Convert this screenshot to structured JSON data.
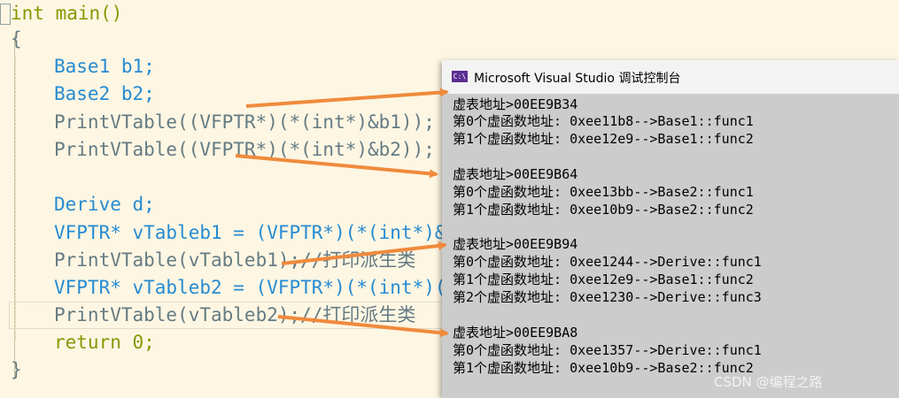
{
  "code": {
    "lines": [
      "int main()",
      "{",
      "Base1 b1;",
      "Base2 b2;",
      "PrintVTable((VFPTR*)(*(int*)&b1));",
      "PrintVTable((VFPTR*)(*(int*)&b2));",
      "Derive d;",
      "VFPTR* vTableb1 = (VFPTR*)(*(int*)&",
      "PrintVTable(vTableb1);//打印派生类",
      "VFPTR* vTableb2 = (VFPTR*)(*(int*)(",
      "PrintVTable(vTableb2);//打印派生类",
      "return 0;",
      "}"
    ]
  },
  "console": {
    "title": "Microsoft Visual Studio 调试控制台",
    "icon_label": "C:\\",
    "lines": [
      "虚表地址>00EE9B34",
      "第0个虚函数地址: 0xee11b8-->Base1::func1",
      "第1个虚函数地址: 0xee12e9-->Base1::func2",
      "虚表地址>00EE9B64",
      "第0个虚函数地址: 0xee13bb-->Base2::func1",
      "第1个虚函数地址: 0xee10b9-->Base2::func2",
      "虚表地址>00EE9B94",
      "第0个虚函数地址: 0xee1244-->Derive::func1",
      "第1个虚函数地址: 0xee12e9-->Base1::func2",
      "第2个虚函数地址: 0xee1230-->Derive::func3",
      "虚表地址>00EE9BA8",
      "第0个虚函数地址: 0xee1357-->Derive::func1",
      "第1个虚函数地址: 0xee10b9-->Base2::func2"
    ]
  },
  "watermark": "CSDN @编程之路",
  "colors": {
    "editor_bg": "#fdf6e3",
    "console_bg": "#cccccc",
    "arrow": "#f08a3c",
    "keyword": "#859900",
    "type": "#268bd2"
  }
}
